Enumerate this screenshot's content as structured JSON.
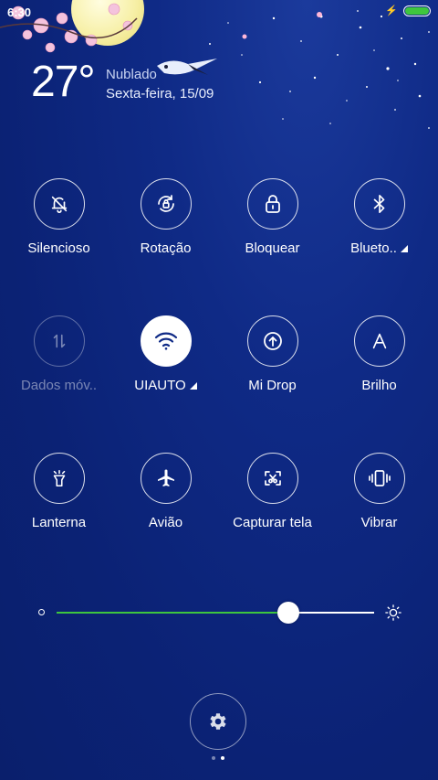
{
  "status_bar": {
    "time": "6:30",
    "battery_level": 1.0,
    "battery_color": "#3ec63e"
  },
  "weather": {
    "temperature": "27°",
    "condition": "Nublado",
    "date": "Sexta-feira, 15/09"
  },
  "tiles": [
    {
      "label": "Silencioso",
      "icon": "bell-off-icon",
      "state": "off"
    },
    {
      "label": "Rotação",
      "icon": "rotation-lock-icon",
      "state": "off"
    },
    {
      "label": "Bloquear",
      "icon": "lock-icon",
      "state": "off"
    },
    {
      "label": "Blueto..",
      "icon": "bluetooth-icon",
      "state": "off",
      "has_menu": true
    },
    {
      "label": "Dados móv..",
      "icon": "mobile-data-icon",
      "state": "disabled"
    },
    {
      "label": "UIAUTO",
      "icon": "wifi-icon",
      "state": "on",
      "has_menu": true
    },
    {
      "label": "Mi Drop",
      "icon": "mi-drop-icon",
      "state": "off"
    },
    {
      "label": "Brilho",
      "icon": "auto-brightness-icon",
      "state": "off"
    },
    {
      "label": "Lanterna",
      "icon": "flashlight-icon",
      "state": "off"
    },
    {
      "label": "Avião",
      "icon": "airplane-icon",
      "state": "off"
    },
    {
      "label": "Capturar tela",
      "icon": "screenshot-icon",
      "state": "off"
    },
    {
      "label": "Vibrar",
      "icon": "vibrate-icon",
      "state": "off"
    }
  ],
  "brightness": {
    "level": 0.73,
    "fill_color": "#3ec63e"
  },
  "pager": {
    "pages": 2,
    "current": 2
  },
  "colors": {
    "background": "#0f2a86",
    "accent": "#3ec63e"
  }
}
